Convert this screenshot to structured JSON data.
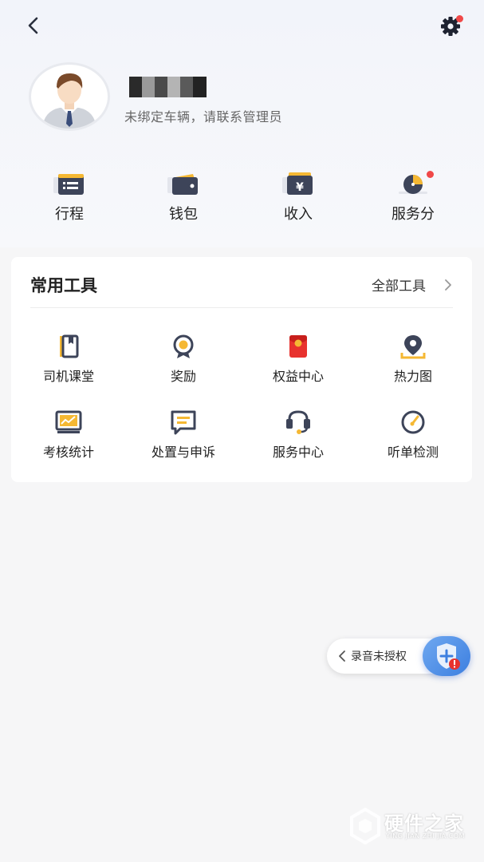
{
  "header": {
    "back_icon": "chevron-left-icon",
    "settings_icon": "gear-icon",
    "settings_badge_color": "#f04848"
  },
  "profile": {
    "avatar_icon": "avatar-icon",
    "name_masked": true,
    "status_text": "未绑定车辆，请联系管理员"
  },
  "quick_entries": [
    {
      "label": "行程",
      "icon": "itinerary-icon"
    },
    {
      "label": "钱包",
      "icon": "wallet-icon"
    },
    {
      "label": "收入",
      "icon": "income-icon"
    },
    {
      "label": "服务分",
      "icon": "service-score-icon",
      "badge": true
    }
  ],
  "tools_card": {
    "title": "常用工具",
    "all_tools_label": "全部工具",
    "items": [
      {
        "label": "司机课堂",
        "icon": "book-icon"
      },
      {
        "label": "奖励",
        "icon": "medal-icon"
      },
      {
        "label": "权益中心",
        "icon": "red-packet-icon"
      },
      {
        "label": "热力图",
        "icon": "map-pin-icon"
      },
      {
        "label": "考核统计",
        "icon": "chart-icon"
      },
      {
        "label": "处置与申诉",
        "icon": "message-icon"
      },
      {
        "label": "服务中心",
        "icon": "headset-icon"
      },
      {
        "label": "听单检测",
        "icon": "gauge-icon"
      }
    ]
  },
  "recording": {
    "label": "录音未授权",
    "icon": "shield-icon"
  },
  "watermark": {
    "title": "硬件之家",
    "subtitle": "YING JIAN ZHI JIA.COM"
  },
  "colors": {
    "accent_yellow": "#f5b833",
    "icon_dark": "#3d4459",
    "badge_red": "#f04848",
    "shield_blue": "#4a8ae6"
  }
}
